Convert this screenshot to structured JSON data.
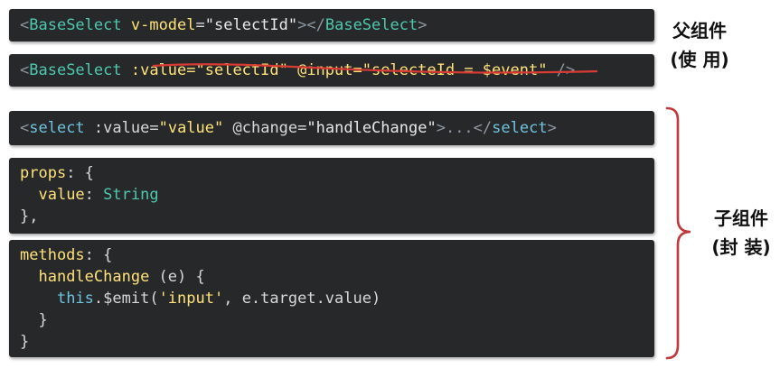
{
  "parent_section": {
    "line1": {
      "open_lt": "<",
      "tag": "BaseSelect",
      "attr": "v-model",
      "eq": "=",
      "value": "\"selectId\"",
      "close_gt": ">",
      "end_tag_open": "</",
      "end_tag": "BaseSelect",
      "end_gt": ">"
    },
    "line2": {
      "open_lt": "<",
      "tag": "BaseSelect",
      "struck_text": ":value=\"selectId\" @input=\"selecteId = $event\"",
      "close": " />"
    },
    "label_line1": "父组件",
    "label_line2": "(使  用)"
  },
  "child_section": {
    "select_line": {
      "open_lt": "<",
      "tag": "select",
      "attr1": ":value",
      "eq1": "=",
      "val1": "\"value\"",
      "attr2": "@change",
      "eq2": "=",
      "val2": "\"handleChange\"",
      "gt": ">",
      "ellipsis": "...",
      "end_open": "</",
      "end_tag": "select",
      "end_gt": ">"
    },
    "props_block": {
      "l1_key": "props",
      "l1_rest": ": {",
      "l2_key": "value",
      "l2_colon": ": ",
      "l2_type": "String",
      "l3": "},"
    },
    "methods_block": {
      "l1_key": "methods",
      "l1_rest": ": {",
      "l2_fn": "handleChange",
      "l2_rest": " (e) {",
      "l3_this": "this",
      "l3_emit": ".$emit(",
      "l3_str": "'input'",
      "l3_rest": ", e.target.value)",
      "l4": "}",
      "l5": "}"
    },
    "label_line1": "子组件",
    "label_line2": "(封  装)"
  },
  "colors": {
    "code_bg": "#26282a",
    "bracket": "#c0393b",
    "strike": "#d83a34"
  }
}
